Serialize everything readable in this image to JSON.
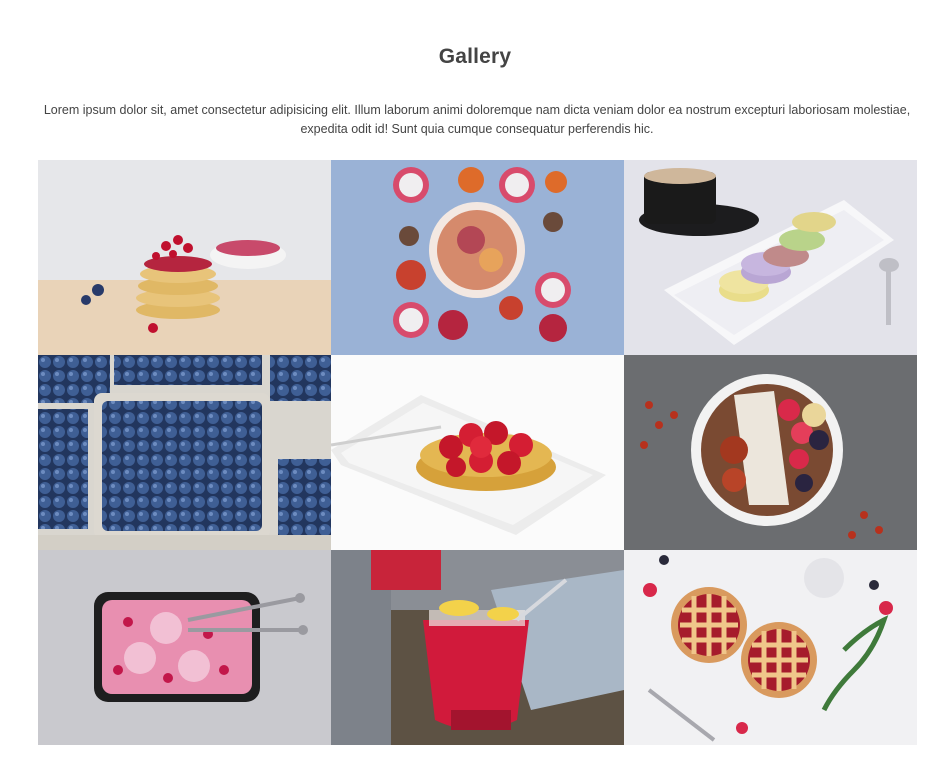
{
  "section": {
    "title": "Gallery",
    "description": "Lorem ipsum dolor sit, amet consectetur adipisicing elit. Illum laborum animi doloremque nam dicta veniam dolor ea nostrum excepturi laboriosam molestiae, expedita odit id! Sunt quia cumque consequatur perferendis hic."
  },
  "gallery": {
    "items": [
      {
        "icon": "pancakes-photo"
      },
      {
        "icon": "fruit-bowl-photo"
      },
      {
        "icon": "coffee-macarons-photo"
      },
      {
        "icon": "blueberries-photo"
      },
      {
        "icon": "raspberry-tart-photo"
      },
      {
        "icon": "smoothie-bowl-photo"
      },
      {
        "icon": "ice-cream-photo"
      },
      {
        "icon": "red-drink-photo"
      },
      {
        "icon": "berry-pies-photo"
      }
    ]
  },
  "colors": {
    "title": "#444444",
    "text": "#444444",
    "background": "#ffffff"
  }
}
